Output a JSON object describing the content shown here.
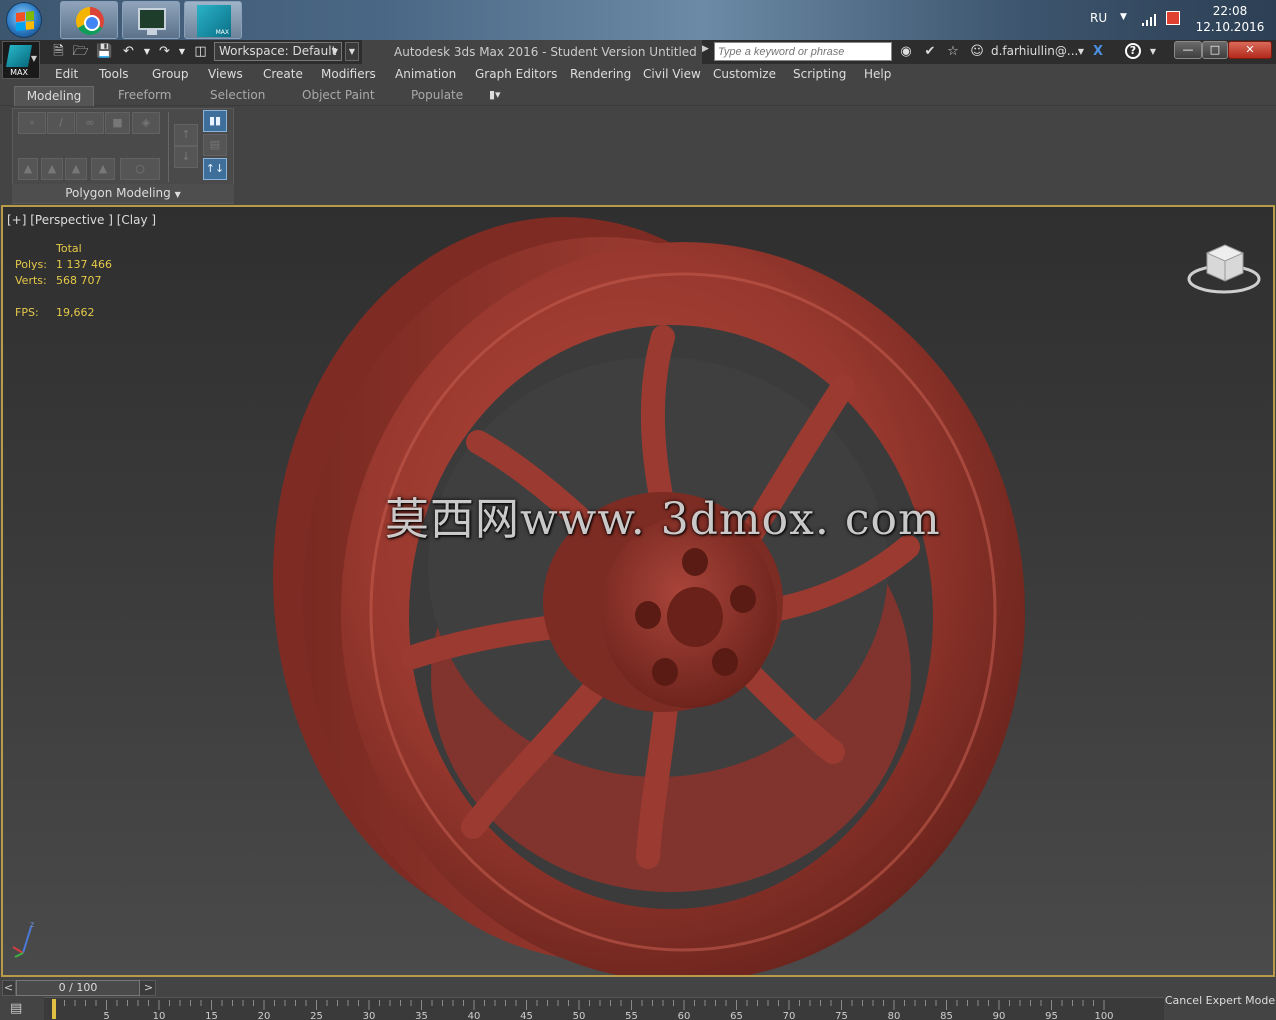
{
  "taskbar": {
    "language": "RU",
    "time": "22:08",
    "date": "12.10.2016",
    "icons": [
      "windows-start-orb",
      "chrome-icon",
      "monitor-icon",
      "3dsmax-icon"
    ]
  },
  "titlebar": {
    "app_title": "Autodesk 3ds Max 2016 - Student Version     Untitled",
    "workspace": "Workspace: Default",
    "search_placeholder": "Type a keyword or phrase",
    "user": "d.farhiullin@...",
    "app_logo_caption": "MAX"
  },
  "menu": [
    "Edit",
    "Tools",
    "Group",
    "Views",
    "Create",
    "Modifiers",
    "Animation",
    "Graph Editors",
    "Rendering",
    "Civil View",
    "Customize",
    "Scripting",
    "Help"
  ],
  "ribbon": {
    "tabs": [
      "Modeling",
      "Freeform",
      "Selection",
      "Object Paint",
      "Populate"
    ],
    "active_tab": "Modeling",
    "panel_label": "Polygon Modeling"
  },
  "viewport": {
    "label": "[+] [Perspective ] [Clay ]",
    "stats": {
      "total_label": "Total",
      "polys_label": "Polys:",
      "polys_value": "1 137 466",
      "verts_label": "Verts:",
      "verts_value": "568 707",
      "fps_label": "FPS:",
      "fps_value": "19,662"
    },
    "watermark": "莫西网www. 3dmox. com",
    "model_color": "#8c3128",
    "border_color": "#b89a4a"
  },
  "timeline": {
    "frame_display": "0 / 100",
    "prev_label": "<",
    "next_label": ">",
    "ticks": [
      "5",
      "10",
      "15",
      "20",
      "25",
      "30",
      "35",
      "40",
      "45",
      "50",
      "55",
      "60",
      "65",
      "70",
      "75",
      "80",
      "85",
      "90",
      "95",
      "100"
    ],
    "cancel_expert_label": "Cancel Expert Mode"
  }
}
